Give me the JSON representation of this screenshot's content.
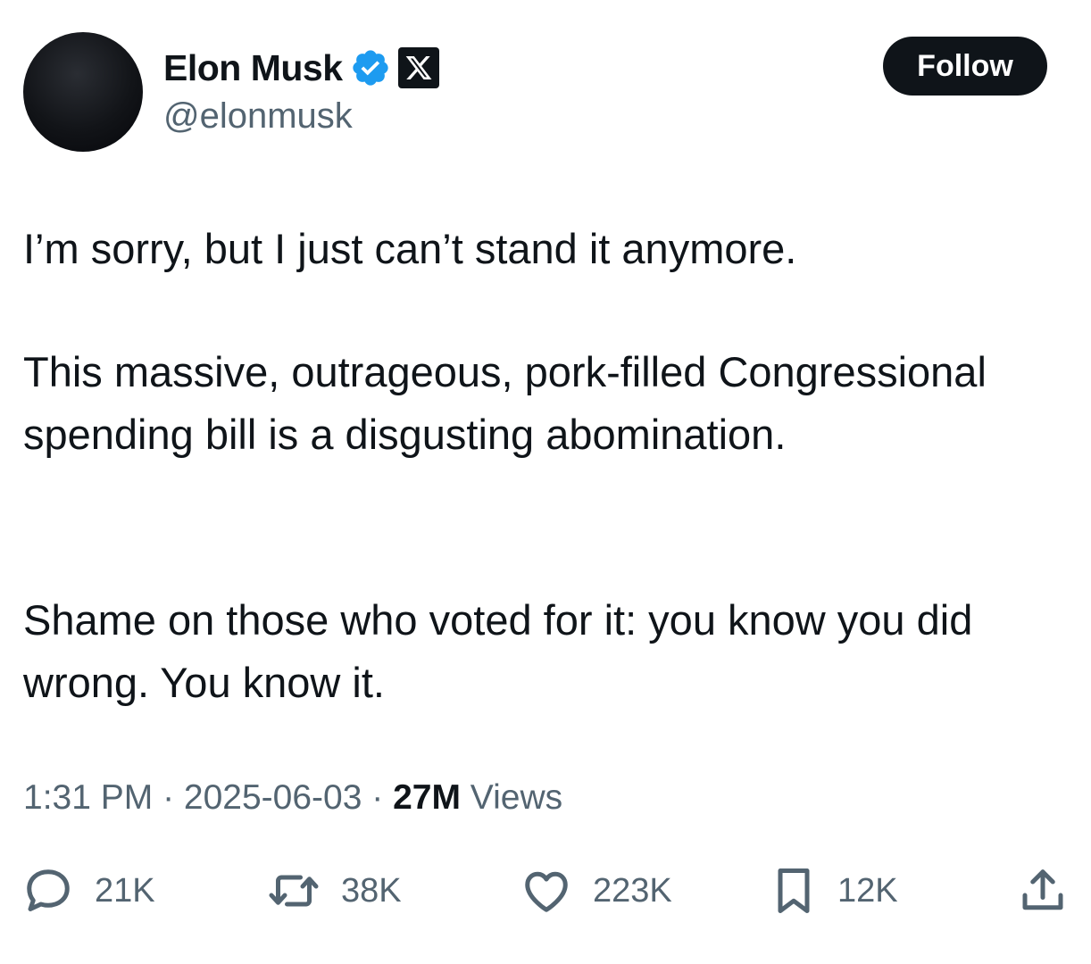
{
  "author": {
    "name": "Elon Musk",
    "handle": "@elonmusk",
    "avatar_color": "#111318",
    "verified_icon": "verified-check-icon",
    "verified_color": "#1d9bf0",
    "affiliate_icon": "x-logo-icon"
  },
  "follow_button": {
    "label": "Follow",
    "color": "#0f1419"
  },
  "tweet": {
    "paragraphs": [
      "I’m sorry, but I just can’t stand it anymore.",
      "This massive, outrageous, pork-filled Congressional spending bill is a disgusting abomination.",
      "Shame on those who voted for it: you know you did wrong. You know it."
    ]
  },
  "meta": {
    "time": "1:31 PM",
    "separator": " · ",
    "date": "2025-06-03",
    "views_count": "27M",
    "views_label": " Views"
  },
  "actions": {
    "reply": {
      "icon": "reply-bubble-icon",
      "count": "21K"
    },
    "repost": {
      "icon": "repost-icon",
      "count": "38K"
    },
    "like": {
      "icon": "heart-icon",
      "count": "223K"
    },
    "bookmark": {
      "icon": "bookmark-icon",
      "count": "12K"
    },
    "share": {
      "icon": "share-icon"
    }
  }
}
